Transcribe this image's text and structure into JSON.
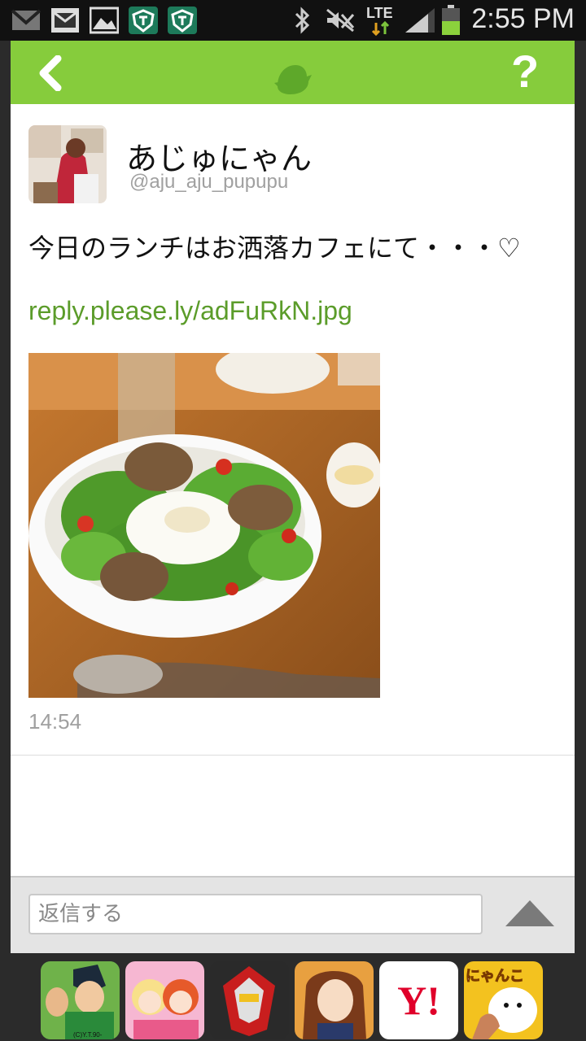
{
  "status_bar": {
    "time": "2:55 PM",
    "network": "LTE",
    "icons": [
      "gmail-icon",
      "message-icon",
      "gallery-icon",
      "shield-app-icon",
      "shield-app-icon",
      "bluetooth-icon",
      "mute-icon",
      "signal-icon",
      "battery-icon"
    ]
  },
  "topbar": {
    "back_icon": "chevron-left-icon",
    "logo_icon": "bird-icon",
    "help_label": "?"
  },
  "tweet": {
    "user_name": "あじゅにゃん",
    "user_handle": "@aju_aju_pupupu",
    "text": "今日のランチはお洒落カフェにて・・・♡",
    "link": "reply.please.ly/adFuRkN.jpg",
    "timestamp": "14:54"
  },
  "reply": {
    "placeholder": "返信する",
    "send_icon": "triangle-up-icon"
  },
  "ads": [
    {
      "name": "ad-app-1",
      "label": "(C)Y.T.90-94/P.S"
    },
    {
      "name": "ad-app-2",
      "label": ""
    },
    {
      "name": "ad-app-3",
      "label": ""
    },
    {
      "name": "ad-app-4",
      "label": ""
    },
    {
      "name": "ad-app-yahoo",
      "label": "Y!"
    },
    {
      "name": "ad-app-nyanko",
      "label": "にゃんこ"
    }
  ],
  "colors": {
    "accent": "#86cc3c",
    "link": "#5b9c2a"
  }
}
